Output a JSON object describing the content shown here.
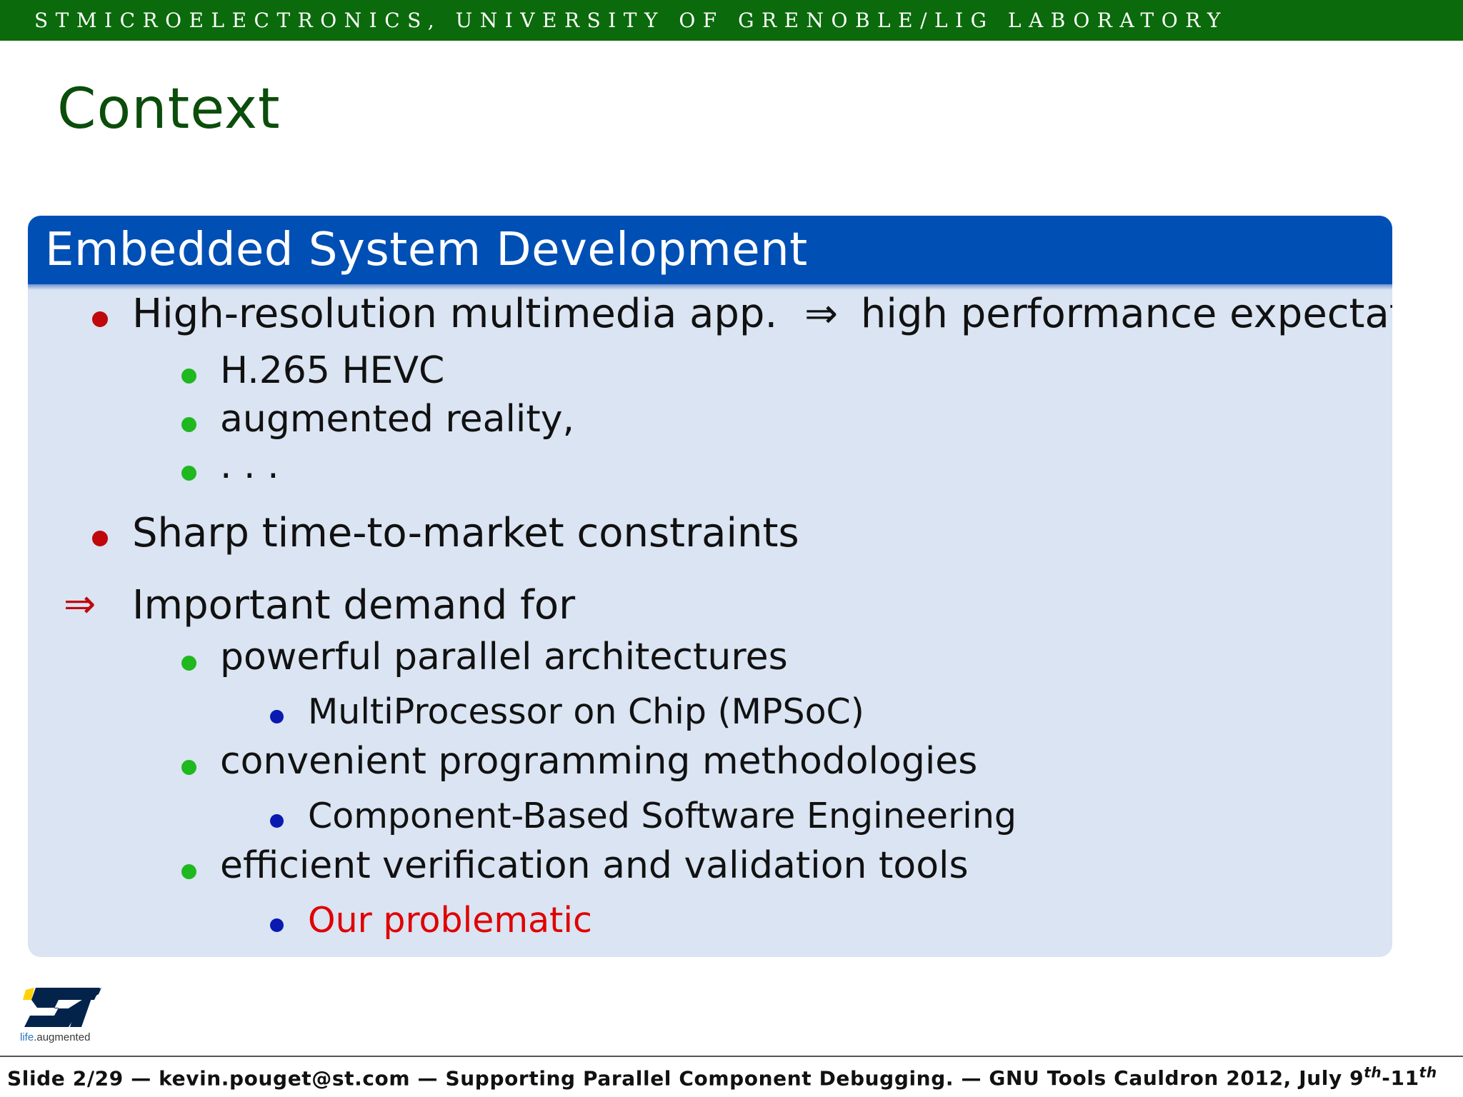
{
  "header_bar": {
    "text": "STMICROELECTRONICS, UNIVERSITY OF GRENOBLE/LIG LABORATORY"
  },
  "slide": {
    "title": "Context"
  },
  "block": {
    "title": "Embedded System Development",
    "items": {
      "high_res": "High-resolution multimedia app.",
      "implies_arrow": "⇒",
      "high_perf": "high performance expectations.",
      "hevc": "H.265 HEVC",
      "ar": "augmented reality,",
      "ellipsis": ". . .",
      "sharp": "Sharp time-to-market constraints",
      "demand_arrow": "⇒",
      "demand": "Important demand for",
      "parallel": "powerful parallel architectures",
      "mpsoc": "MultiProcessor on Chip (MPSoC)",
      "programming": "convenient programming methodologies",
      "cbse": "Component-Based Software Engineering",
      "verification": "efficient verification and validation tools",
      "problematic": "Our problematic"
    },
    "colors": {
      "level1_bullet": "#c0070c",
      "level2_bullet": "#1fb81f",
      "level3_bullet": "#0a19b0",
      "highlight": "#e00000"
    }
  },
  "logo": {
    "text_life": "life",
    "text_augmented": ".augmented"
  },
  "footer": {
    "slide": "Slide 2/29",
    "sep1": "—",
    "email": "kevin.pouget@st.com",
    "sep2": "—",
    "talk": "Supporting Parallel Component Debugging.",
    "sep3": "—",
    "event": "GNU Tools Cauldron 2012, July 9",
    "sup1": "th",
    "dash": "-11",
    "sup2": "th"
  }
}
